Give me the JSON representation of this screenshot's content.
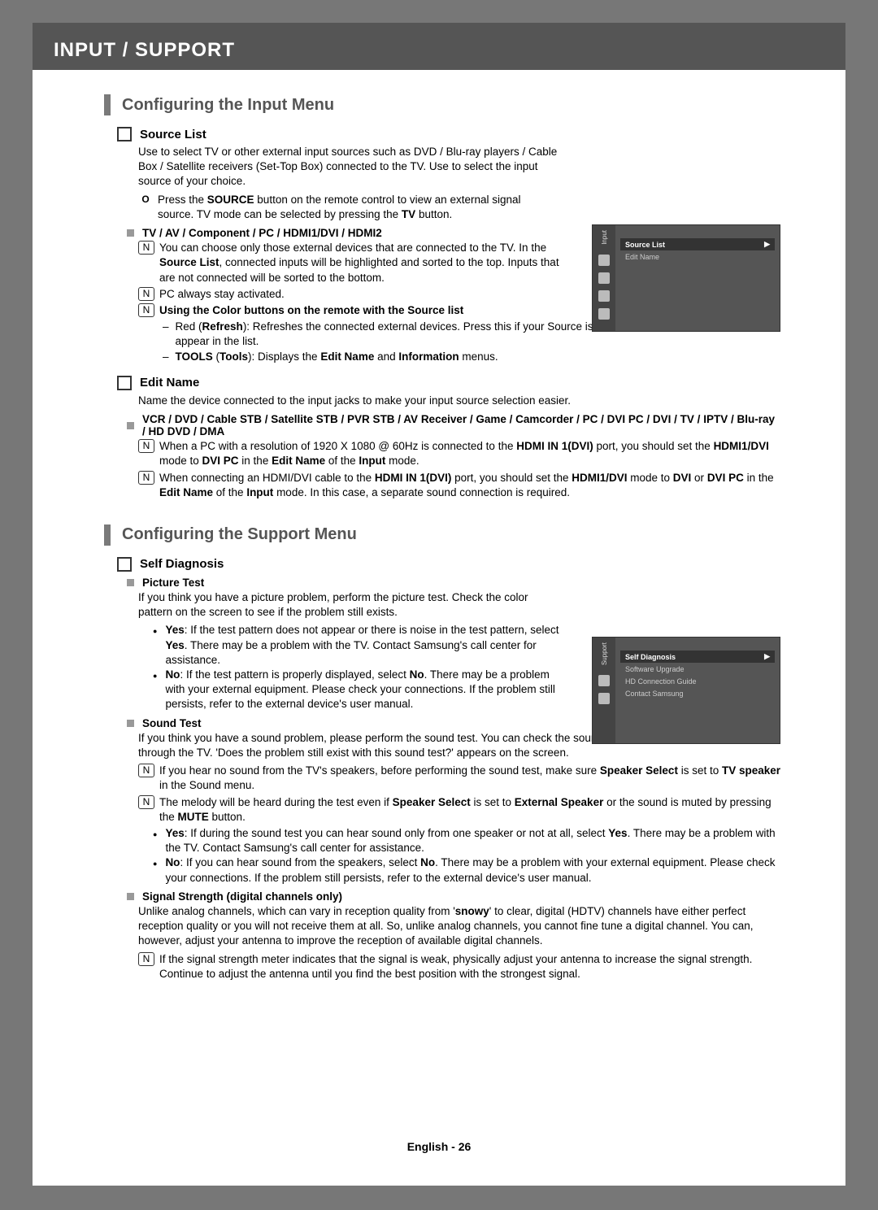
{
  "chapter": "INPUT / SUPPORT",
  "s1": {
    "title": "Configuring the Input Menu",
    "sourceList": {
      "head": "Source List",
      "desc": "Use to select TV or other external input sources such as DVD / Blu-ray players / Cable Box / Satellite receivers (Set-Top Box) connected to the TV. Use to select the input source of your choice.",
      "remote1a": "Press the ",
      "remote1b": " button on the remote control to view an external signal source. TV mode can be selected by pressing the ",
      "remote1c": " button.",
      "sourceBtn": "SOURCE",
      "tvBtn": "TV",
      "inputs": "TV / AV / Component / PC / HDMI1/DVI / HDMI2",
      "n1a": "You can choose only those external devices that are connected to the TV. In the ",
      "n1b": ", connected inputs will be highlighted and sorted to the top. Inputs that are not connected will be sorted to the bottom.",
      "srcList": "Source List",
      "n2": "PC always stay activated.",
      "n3": "Using the Color buttons on the remote with the Source list",
      "red1": "Red (",
      "red2": "): Refreshes the connected external devices. Press this if your Source is on and connected, but does not appear in the list.",
      "refresh": "Refresh",
      "tools1a": "TOOLS",
      "tools1b": " (",
      "tools1c": "Tools",
      "tools1d": "): Displays the ",
      "tools1e": "Edit Name",
      "tools1f": " and ",
      "tools1g": "Information",
      "tools1h": " menus."
    },
    "editName": {
      "head": "Edit Name",
      "desc": "Name the device connected to the input jacks to make your input source selection easier.",
      "list": "VCR / DVD / Cable STB / Satellite STB / PVR STB / AV Receiver / Game / Camcorder / PC / DVI PC / DVI / TV / IPTV / Blu-ray / HD DVD / DMA",
      "n1a": "When a PC with a resolution of 1920 X 1080 @ 60Hz is connected to the ",
      "n1b": " port, you should set the ",
      "n1c": " mode to ",
      "n1d": " in the ",
      "n1e": " of the ",
      "n1f": " mode.",
      "hdmi1": "HDMI IN 1(DVI)",
      "hdmi1dvi": "HDMI1/DVI",
      "dviPC": "DVI PC",
      "editNameB": "Edit Name",
      "inputB": "Input",
      "n2a": "When connecting an HDMI/DVI cable to the ",
      "n2b": " port, you should set the ",
      "n2c": " mode to ",
      "n2d": " or ",
      "n2e": " in the ",
      "n2f": " of the ",
      "n2g": " mode. In this case, a separate sound connection is required.",
      "dvi": "DVI"
    }
  },
  "s2": {
    "title": "Configuring the Support Menu",
    "selfDiag": {
      "head": "Self Diagnosis",
      "pic": {
        "head": "Picture Test",
        "desc": "If you think you have a picture problem, perform the picture test. Check the color pattern on the screen to see if the problem still exists.",
        "yes1": ": If the test pattern does not appear or there is noise in the test pattern, select ",
        "yes2": ". There may be a problem with the TV. Contact Samsung's call center for assistance.",
        "no1": ": If the test pattern is properly displayed, select ",
        "no2": ". There may be a problem with your external equipment. Please check your connections. If the problem still persists, refer to the external device's user manual."
      },
      "snd": {
        "head": "Sound Test",
        "desc": "If you think you have a sound problem, please perform the sound test. You can check the sound by playing a built-in melody sound through the TV. 'Does the problem still exist with this sound test?' appears on the screen.",
        "n1a": "If you hear no sound from the TV's speakers, before performing the sound test, make sure ",
        "n1b": " is set to ",
        "n1c": " in the Sound menu.",
        "spksel": "Speaker Select",
        "tvspk": "TV speaker",
        "n2a": "The melody will be heard during the test even if ",
        "n2b": " is set to ",
        "n2c": " or the sound is muted by pressing the ",
        "n2d": " button.",
        "ext": "External Speaker",
        "mute": "MUTE",
        "yes1": ": If during the sound test you can hear sound only from one speaker or not at all, select ",
        "yes2": ". There may be a problem with the TV. Contact Samsung's call center for assistance.",
        "no1": ": If you can hear sound from the speakers, select ",
        "no2": ". There may be a problem with your external equipment. Please check your connections. If the problem still persists, refer to the external device's user manual."
      },
      "sig": {
        "head": "Signal Strength (digital channels only)",
        "desc": "Unlike analog channels, which can vary in reception quality from 'snowy' to clear, digital (HDTV) channels have either perfect reception quality or you will not receive them at all. So, unlike analog channels, you cannot fine tune a digital channel. You can, however, adjust your antenna to improve the reception of available digital channels.",
        "snowy": "snowy",
        "n1": "If the signal strength meter indicates that the signal is weak, physically adjust your antenna to increase the signal strength. Continue to adjust the antenna until you find the best position with the strongest signal."
      }
    }
  },
  "tv1": {
    "sidebar": "Input",
    "items": [
      "Source List",
      "Edit Name"
    ]
  },
  "tv2": {
    "sidebar": "Support",
    "items": [
      "Self Diagnosis",
      "Software Upgrade",
      "HD Connection Guide",
      "Contact Samsung"
    ]
  },
  "yes": "Yes",
  "no": "No",
  "noteGlyph": "N",
  "remGlyph": "O",
  "footer": "English - 26"
}
